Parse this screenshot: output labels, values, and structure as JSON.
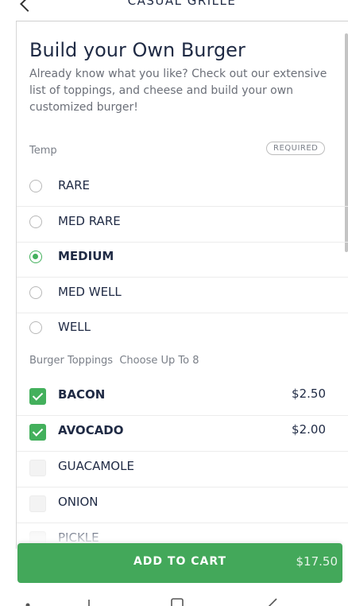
{
  "header": {
    "title": "CASUAL GRILLE"
  },
  "item": {
    "title": "Build your Own Burger",
    "description": "Already know what you like? Check out our extensive list of toppings, and cheese and build your own customized burger!"
  },
  "temp": {
    "label": "Temp",
    "badge": "REQUIRED",
    "options": [
      {
        "label": "RARE",
        "selected": false
      },
      {
        "label": "MED RARE",
        "selected": false
      },
      {
        "label": "MEDIUM",
        "selected": true
      },
      {
        "label": "MED WELL",
        "selected": false
      },
      {
        "label": "WELL",
        "selected": false
      }
    ]
  },
  "toppings": {
    "label": "Burger Toppings",
    "hint": "Choose Up To 8",
    "options": [
      {
        "label": "BACON",
        "price": "$2.50",
        "checked": true
      },
      {
        "label": "AVOCADO",
        "price": "$2.00",
        "checked": true
      },
      {
        "label": "GUACAMOLE",
        "price": "",
        "checked": false
      },
      {
        "label": "ONION",
        "price": "",
        "checked": false
      },
      {
        "label": "PICKLE",
        "price": "",
        "checked": false
      }
    ]
  },
  "cart": {
    "label": "ADD TO CART",
    "total": "$17.50"
  },
  "colors": {
    "accent_green": "#43b05c",
    "button_green": "#43a85a",
    "text_dark": "#1f2a44",
    "text_muted": "#6b6f78"
  },
  "icons": [
    "back-chevron-icon",
    "radio-selected-icon",
    "checkbox-checked-icon",
    "nav-recents-icon",
    "nav-home-icon",
    "nav-back-icon"
  ]
}
